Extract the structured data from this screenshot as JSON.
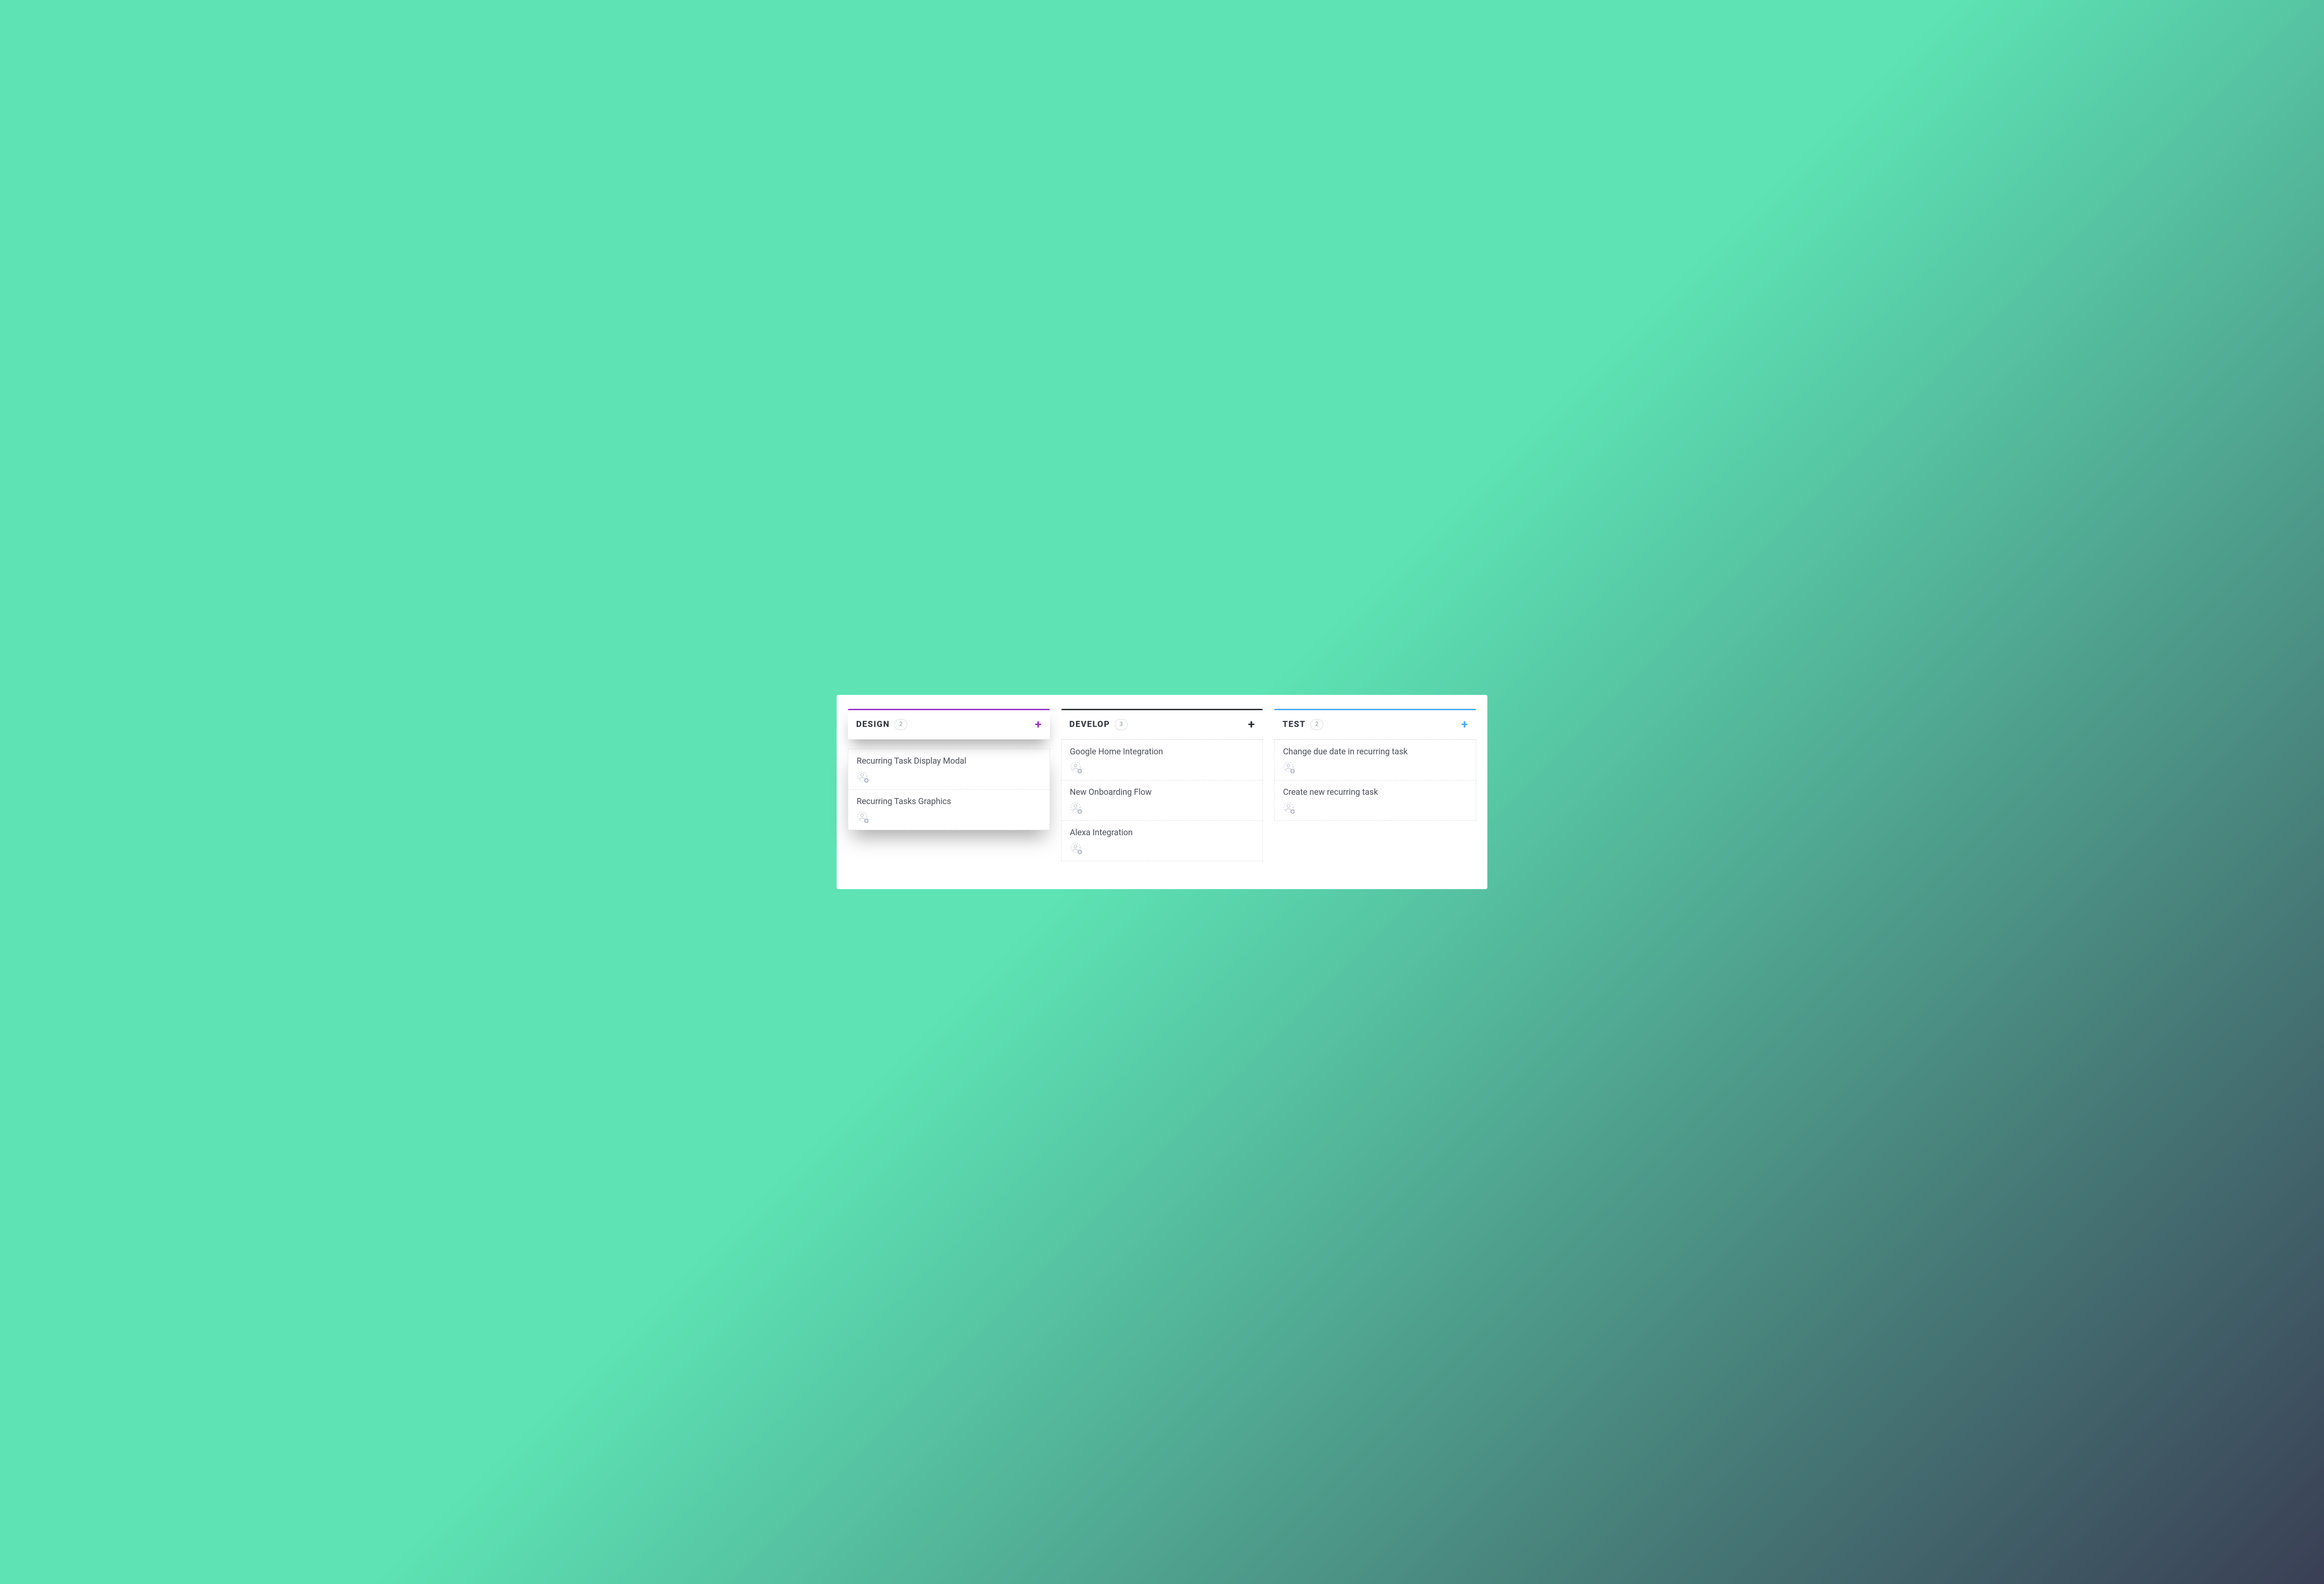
{
  "board": {
    "columns": [
      {
        "id": "design",
        "title": "DESIGN",
        "count": "2",
        "accent": "accent-purple",
        "elevated": true,
        "cards": [
          {
            "title": "Recurring Task Display Modal"
          },
          {
            "title": "Recurring Tasks Graphics"
          }
        ]
      },
      {
        "id": "develop",
        "title": "DEVELOP",
        "count": "3",
        "accent": "accent-dark",
        "elevated": false,
        "cards": [
          {
            "title": "Google Home Integration"
          },
          {
            "title": "New Onboarding Flow"
          },
          {
            "title": "Alexa Integration"
          }
        ]
      },
      {
        "id": "test",
        "title": "TEST",
        "count": "2",
        "accent": "accent-blue",
        "elevated": false,
        "cards": [
          {
            "title": "Change due date in recurring task"
          },
          {
            "title": "Create new recurring task"
          }
        ]
      }
    ]
  },
  "icons": {
    "plus_glyph": "+"
  }
}
